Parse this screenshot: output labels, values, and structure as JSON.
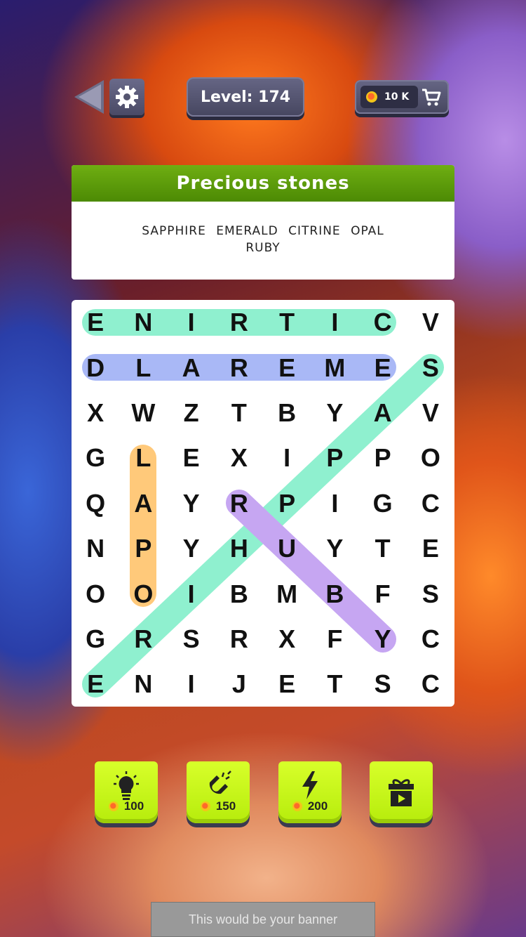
{
  "header": {
    "level_label": "Level: 174",
    "coins_label": "10 K"
  },
  "category": {
    "title": "Precious stones",
    "words": [
      "SAPPHIRE",
      "EMERALD",
      "CITRINE",
      "OPAL",
      "RUBY"
    ]
  },
  "grid": {
    "rows": [
      [
        "E",
        "N",
        "I",
        "R",
        "T",
        "I",
        "C",
        "V"
      ],
      [
        "D",
        "L",
        "A",
        "R",
        "E",
        "M",
        "E",
        "S"
      ],
      [
        "X",
        "W",
        "Z",
        "T",
        "B",
        "Y",
        "A",
        "V"
      ],
      [
        "G",
        "L",
        "E",
        "X",
        "I",
        "P",
        "P",
        "O"
      ],
      [
        "Q",
        "A",
        "Y",
        "R",
        "P",
        "I",
        "G",
        "C"
      ],
      [
        "N",
        "P",
        "Y",
        "H",
        "U",
        "Y",
        "T",
        "E"
      ],
      [
        "O",
        "O",
        "I",
        "B",
        "M",
        "B",
        "F",
        "S"
      ],
      [
        "G",
        "R",
        "S",
        "R",
        "X",
        "F",
        "Y",
        "C"
      ],
      [
        "E",
        "N",
        "I",
        "J",
        "E",
        "T",
        "S",
        "C"
      ]
    ],
    "found_words": [
      {
        "word": "CITRINE",
        "color": "#8ff0cf"
      },
      {
        "word": "EMERALD",
        "color": "#a9b8f6"
      },
      {
        "word": "SAPPHIRE",
        "color": "#8ff0cf"
      },
      {
        "word": "OPAL",
        "color": "#ffc97a"
      },
      {
        "word": "RUBY",
        "color": "#c6a6f2"
      }
    ]
  },
  "boosters": [
    {
      "name": "hint",
      "price": "100"
    },
    {
      "name": "magnet",
      "price": "150"
    },
    {
      "name": "lightning",
      "price": "200"
    },
    {
      "name": "gift-video",
      "price": ""
    }
  ],
  "banner": {
    "text": "This would be your banner"
  },
  "colors": {
    "category_header": "#5c9a08",
    "booster": "#c8f51a",
    "pill": "#55556f"
  }
}
